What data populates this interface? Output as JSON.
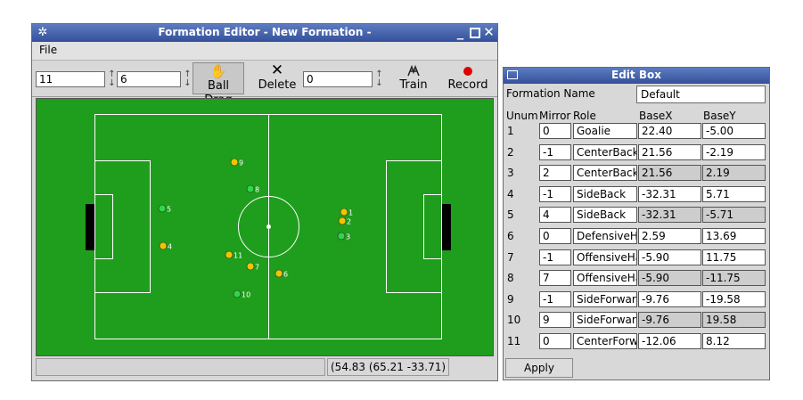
{
  "formation_editor": {
    "title": "Formation Editor - New Formation -",
    "menu": {
      "file": "File"
    },
    "toolbar": {
      "spin1_value": "11",
      "spin2_value": "6",
      "ball_drag_label": "Ball Drag",
      "delete_label": "Delete",
      "spin3_value": "0",
      "train_label": "Train",
      "record_label": "Record"
    },
    "status": {
      "coords": "(54.83 (65.21 -33.71)"
    },
    "players": [
      {
        "unum": "1",
        "team": "yellow"
      },
      {
        "unum": "2",
        "team": "yellow"
      },
      {
        "unum": "3",
        "team": "green"
      },
      {
        "unum": "4",
        "team": "yellow"
      },
      {
        "unum": "5",
        "team": "green"
      },
      {
        "unum": "6",
        "team": "yellow"
      },
      {
        "unum": "7",
        "team": "yellow"
      },
      {
        "unum": "8",
        "team": "green"
      },
      {
        "unum": "9",
        "team": "yellow"
      },
      {
        "unum": "10",
        "team": "green"
      },
      {
        "unum": "11",
        "team": "yellow"
      }
    ],
    "colors": {
      "field": "#1f9d1c",
      "yellow_player": "#f2c400",
      "green_player": "#2fd64a",
      "line": "#ffffff"
    }
  },
  "edit_box": {
    "title": "Edit Box",
    "formation_name_label": "Formation Name",
    "formation_name_value": "Default",
    "headers": {
      "unum": "Unum",
      "mirror": "Mirror",
      "role": "Role",
      "basex": "BaseX",
      "basey": "BaseY"
    },
    "rows": [
      {
        "unum": "1",
        "mirror": "0",
        "role": "Goalie",
        "basex": "22.40",
        "basey": "-5.00"
      },
      {
        "unum": "2",
        "mirror": "-1",
        "role": "CenterBack",
        "basex": "21.56",
        "basey": "-2.19"
      },
      {
        "unum": "3",
        "mirror": "2",
        "role": "CenterBack",
        "basex": "21.56",
        "basey": "2.19"
      },
      {
        "unum": "4",
        "mirror": "-1",
        "role": "SideBack",
        "basex": "-32.31",
        "basey": "5.71"
      },
      {
        "unum": "5",
        "mirror": "4",
        "role": "SideBack",
        "basex": "-32.31",
        "basey": "-5.71"
      },
      {
        "unum": "6",
        "mirror": "0",
        "role": "DefensiveH",
        "basex": "2.59",
        "basey": "13.69"
      },
      {
        "unum": "7",
        "mirror": "-1",
        "role": "OffensiveHa",
        "basex": "-5.90",
        "basey": "11.75"
      },
      {
        "unum": "8",
        "mirror": "7",
        "role": "OffensiveHa",
        "basex": "-5.90",
        "basey": "-11.75"
      },
      {
        "unum": "9",
        "mirror": "-1",
        "role": "SideForwar",
        "basex": "-9.76",
        "basey": "-19.58"
      },
      {
        "unum": "10",
        "mirror": "9",
        "role": "SideForwar",
        "basex": "-9.76",
        "basey": "19.58"
      },
      {
        "unum": "11",
        "mirror": "0",
        "role": "CenterForw",
        "basex": "-12.06",
        "basey": "8.12"
      }
    ],
    "apply_label": "Apply"
  }
}
